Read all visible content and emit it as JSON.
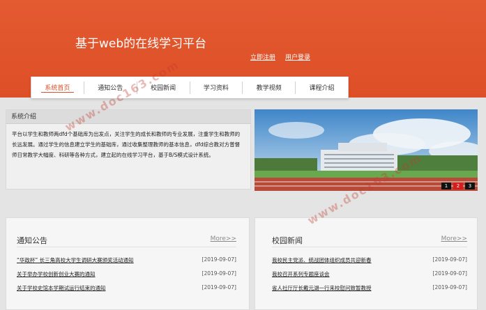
{
  "site": {
    "title": "基于web的在线学习平台"
  },
  "top_links": [
    "立即注册",
    "用户登录"
  ],
  "nav": [
    {
      "label": "系统首页",
      "active": true
    },
    {
      "label": "通知公告",
      "active": false
    },
    {
      "label": "校园新闻",
      "active": false
    },
    {
      "label": "学习资料",
      "active": false
    },
    {
      "label": "教学视频",
      "active": false
    },
    {
      "label": "课程介绍",
      "active": false
    }
  ],
  "intro": {
    "heading": "系统介绍",
    "text": "平台以学生和教师两dfd个基础库为出发点，关注学生的成长和教师的专业发展，注重学生和教师的长远发展。通过学生的信息建立学生的基础库，通过收集整理教师的基本信息，dfd综合教对方普督师日常教学大幅度、科研等各种方式，建立起的在线学习平台，基于B/S模式设计系统。"
  },
  "banner": {
    "dots": [
      "1",
      "2",
      "3"
    ],
    "active_index": 1
  },
  "notices": {
    "title": "通知公告",
    "more": "More>>",
    "items": [
      {
        "text": "“华政杯” 长三角高校大学生调研大赛颁奖活动通知",
        "date": "[2019-09-07]"
      },
      {
        "text": "关于举办学校创新创业大赛的通知",
        "date": "[2019-09-07]"
      },
      {
        "text": "关于学校史馆本学期试运行结束的通知",
        "date": "[2019-09-07]"
      }
    ]
  },
  "news": {
    "title": "校园新闻",
    "more": "More>>",
    "items": [
      {
        "text": "我校民主党派、统战团体组织成员共迎新春",
        "date": "[2019-09-07]"
      },
      {
        "text": "我校召开系列专题座谈会",
        "date": "[2019-09-07]"
      },
      {
        "text": "省人社厅厅长戴元湖一行来校慰问致暂教授",
        "date": "[2019-09-07]"
      }
    ]
  },
  "watermark": "www.doc163.com"
}
